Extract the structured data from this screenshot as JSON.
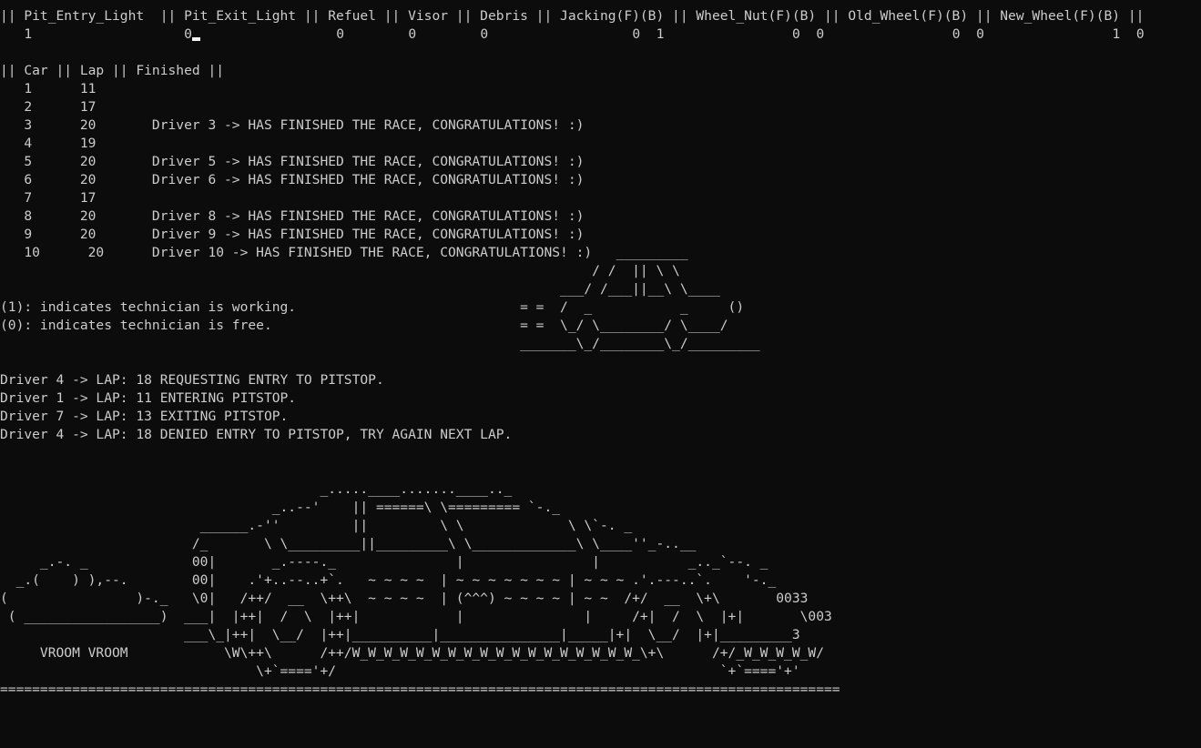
{
  "terminal": {
    "pit_header": "|| Pit_Entry_Light  || Pit_Exit_Light || Refuel || Visor || Debris || Jacking(F)(B) || Wheel_Nut(F)(B) || Old_Wheel(F)(B) || New_Wheel(F)(B) ||",
    "pit_values_pre_cursor": "   1                   0",
    "pit_values_post_cursor": "                 0        0        0                  0  1                0  0                0  0                1  0",
    "race_header": "|| Car || Lap || Finished ||",
    "race_rows": [
      "   1      11",
      "   2      17",
      "   3      20       Driver 3 -> HAS FINISHED THE RACE, CONGRATULATIONS! :)",
      "   4      19",
      "   5      20       Driver 5 -> HAS FINISHED THE RACE, CONGRATULATIONS! :)",
      "   6      20       Driver 6 -> HAS FINISHED THE RACE, CONGRATULATIONS! :)",
      "   7      17",
      "   8      20       Driver 8 -> HAS FINISHED THE RACE, CONGRATULATIONS! :)",
      "   9      20       Driver 9 -> HAS FINISHED THE RACE, CONGRATULATIONS! :)",
      "   10      20      Driver 10 -> HAS FINISHED THE RACE, CONGRATULATIONS! :)   _________"
    ],
    "small_car_lines": [
      "                                                                          / /  || \\ \\",
      "                                                                      ___/ /___||__\\ \\____",
      "(1): indicates technician is working.                            = =  /  _           _     ()",
      "(0): indicates technician is free.                               = =  \\_/ \\________/ \\____/",
      "                                                                 _______\\_/________\\_/_________"
    ],
    "pit_events": [
      "Driver 4 -> LAP: 18 REQUESTING ENTRY TO PITSTOP.",
      "Driver 1 -> LAP: 11 ENTERING PITSTOP.",
      "Driver 7 -> LAP: 13 EXITING PITSTOP.",
      "Driver 4 -> LAP: 18 DENIED ENTRY TO PITSTOP, TRY AGAIN NEXT LAP."
    ],
    "big_car_lines": [
      "                                        _.....____.......____.._",
      "                                  _..--'    || ======\\ \\========= `-._",
      "                         ______.-''         ||         \\ \\             \\ \\`-. _",
      "                        /_       \\ \\_________||_________\\ \\_____________\\ \\____''_-..__",
      "     _.-. _             00|       _.----._               |                |           _.._`--. _",
      "  _.(    ) ),--.        00|    .'+..--..+`.   ~ ~ ~ ~  | ~ ~ ~ ~ ~ ~ ~ | ~ ~ ~ .'.---..`.    '-._",
      "(                )-._   \\0|   /++/  __  \\++\\  ~ ~ ~ ~  | (^^^) ~ ~ ~ ~ | ~ ~  /+/  __  \\+\\       0033",
      " ( _________________)  ___|  |++|  /  \\  |++|            |               |     /+|  /  \\  |+|       \\003",
      "                       ___\\_|++|  \\__/  |++|__________|_______________|_____|+|  \\__/  |+|_________3",
      "     VROOM VROOM            \\W\\++\\      /++/W_W_W_W_W_W_W_W_W_W_W_W_W_W_W_W_W_W_\\+\\      /+/_W_W_W_W_W/",
      "                                \\+`===='+/                                                `+`===='+'"
    ],
    "separator": "========================================================================================================="
  }
}
